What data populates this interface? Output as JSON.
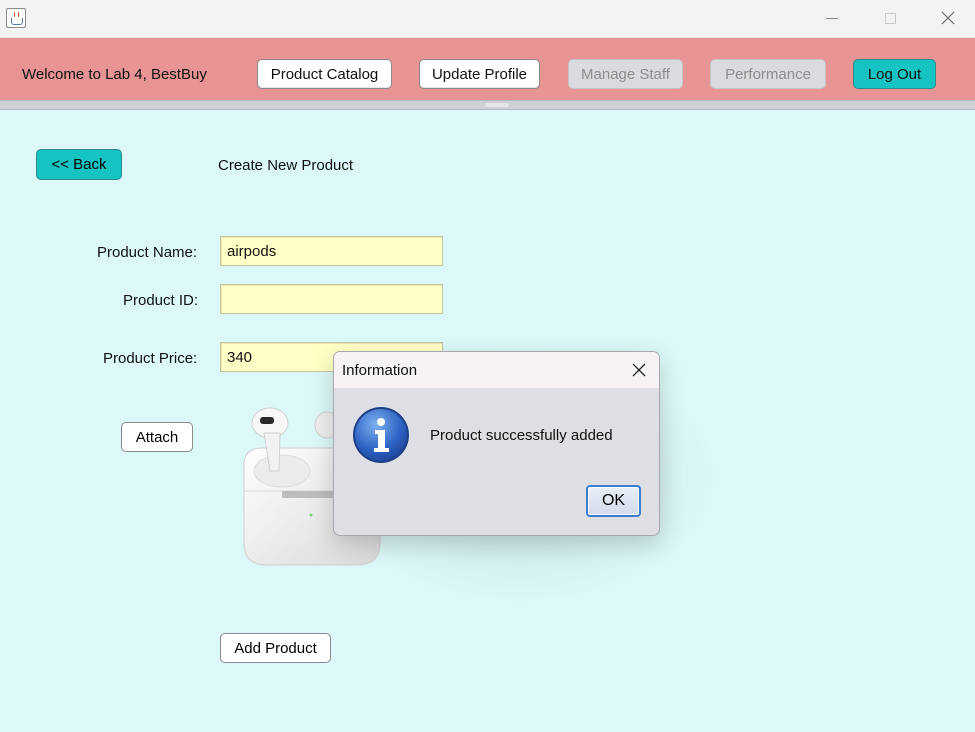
{
  "window": {
    "icon": "java-cup-icon"
  },
  "header": {
    "welcome": "Welcome to Lab 4, BestBuy",
    "buttons": {
      "product_catalog": "Product Catalog",
      "update_profile": "Update Profile",
      "manage_staff": "Manage Staff",
      "performance": "Performance",
      "log_out": "Log Out"
    }
  },
  "main": {
    "back_label": "<< Back",
    "page_title": "Create New Product",
    "fields": {
      "name": {
        "label": "Product Name:",
        "value": "airpods"
      },
      "id": {
        "label": "Product ID:",
        "value": ""
      },
      "price": {
        "label": "Product Price:",
        "value": "340"
      }
    },
    "attach_label": "Attach",
    "add_label": "Add Product",
    "image": "airpods-product-image"
  },
  "dialog": {
    "title": "Information",
    "message": "Product successfully added",
    "ok_label": "OK",
    "icon": "info-icon"
  },
  "colors": {
    "header_bg": "#e89494",
    "main_bg": "#dcf8f8",
    "accent_teal": "#15c3c3",
    "field_bg": "#ffffc6"
  }
}
